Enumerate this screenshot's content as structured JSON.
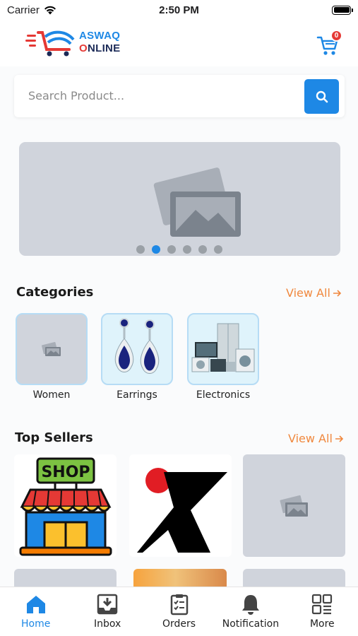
{
  "status_bar": {
    "carrier": "Carrier",
    "time": "2:50 PM"
  },
  "header": {
    "logo_line1": "ASWAQ",
    "logo_line2_pre": "",
    "logo_line2_o": "O",
    "logo_line2_rest": "NLINE",
    "cart_count": "0"
  },
  "search": {
    "placeholder": "Search Product..."
  },
  "banner": {
    "dot_count": 6,
    "active_dot": 1
  },
  "categories": {
    "title": "Categories",
    "view_all": "View All",
    "items": [
      {
        "label": "Women",
        "image": "placeholder-icon"
      },
      {
        "label": "Earrings",
        "image": "earrings-photo"
      },
      {
        "label": "Electronics",
        "image": "electronics-photo"
      }
    ]
  },
  "top_sellers": {
    "title": "Top Sellers",
    "view_all": "View All",
    "items": [
      {
        "image": "shop-storefront-logo"
      },
      {
        "image": "x-brand-logo"
      },
      {
        "image": "placeholder-icon"
      },
      {
        "image": "placeholder-icon"
      },
      {
        "image": "orange-photo"
      },
      {
        "image": "placeholder-icon"
      }
    ]
  },
  "tabbar": {
    "items": [
      {
        "label": "Home",
        "icon": "home-icon",
        "active": true
      },
      {
        "label": "Inbox",
        "icon": "inbox-icon",
        "active": false
      },
      {
        "label": "Orders",
        "icon": "orders-icon",
        "active": false
      },
      {
        "label": "Notification",
        "icon": "bell-icon",
        "active": false
      },
      {
        "label": "More",
        "icon": "grid-icon",
        "active": false
      }
    ]
  },
  "colors": {
    "accent": "#1e88e5",
    "view_all": "#f0883e",
    "badge": "#e53935",
    "placeholder_bg": "#d0d4dc"
  }
}
